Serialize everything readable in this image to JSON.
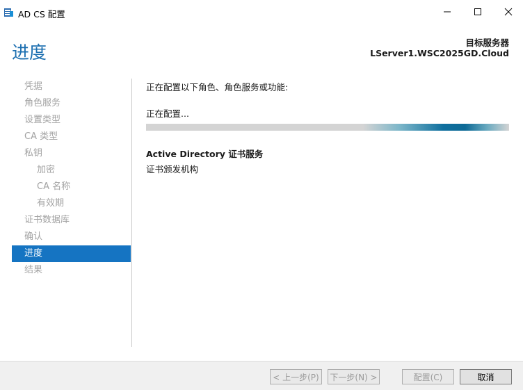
{
  "window": {
    "title": "AD CS 配置",
    "minimize_glyph": "—",
    "maximize_glyph": "☐",
    "close_glyph": "✕"
  },
  "header": {
    "page_title": "进度",
    "target_label": "目标服务器",
    "target_server": "LServer1.WSC2025GD.Cloud"
  },
  "nav": {
    "items": [
      {
        "label": "凭据"
      },
      {
        "label": "角色服务"
      },
      {
        "label": "设置类型"
      },
      {
        "label": "CA 类型"
      },
      {
        "label": "私钥"
      },
      {
        "label": "加密"
      },
      {
        "label": "CA 名称"
      },
      {
        "label": "有效期"
      },
      {
        "label": "证书数据库"
      },
      {
        "label": "确认"
      },
      {
        "label": "进度"
      },
      {
        "label": "结果"
      }
    ],
    "active_index": 10
  },
  "main": {
    "intro": "正在配置以下角色、角色服务或功能:",
    "status": "正在配置...",
    "progress_fraction": 0.55,
    "role_name": "Active Directory 证书服务",
    "role_service": "证书颁发机构"
  },
  "footer": {
    "prev_label": "< 上一步(P)",
    "next_label": "下一步(N) >",
    "configure_label": "配置(C)",
    "cancel_label": "取消"
  },
  "colors": {
    "accent": "#1574c2",
    "title": "#1c6fb0",
    "progress": "#0f6f9e"
  }
}
